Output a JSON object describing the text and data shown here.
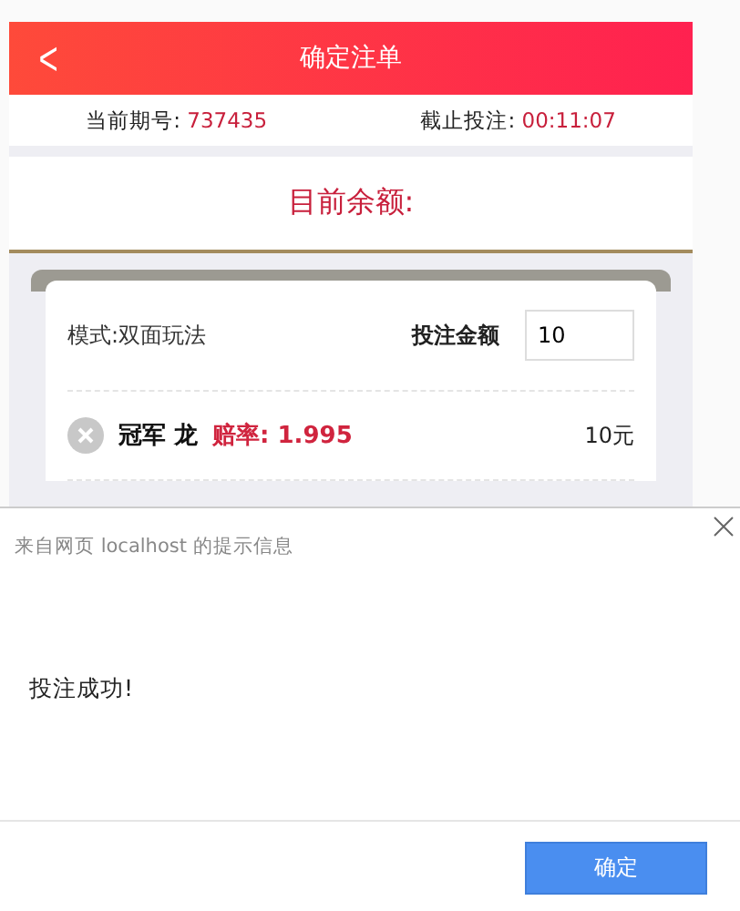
{
  "header": {
    "back": "<",
    "title": "确定注单"
  },
  "info": {
    "issue_label": "当前期号:",
    "issue": "737435",
    "deadline_label": "截止投注:",
    "deadline": "00:11:07"
  },
  "balance": {
    "label": "目前余额:"
  },
  "bet": {
    "mode": "模式:双面玩法",
    "amount_label": "投注金额",
    "amount": "10"
  },
  "items": [
    {
      "name": "冠军 龙",
      "odds": "赔率: 1.995",
      "amount": "10元"
    }
  ],
  "dialog": {
    "title": "来自网页 localhost 的提示信息",
    "message": "投注成功!",
    "button": "确定"
  }
}
